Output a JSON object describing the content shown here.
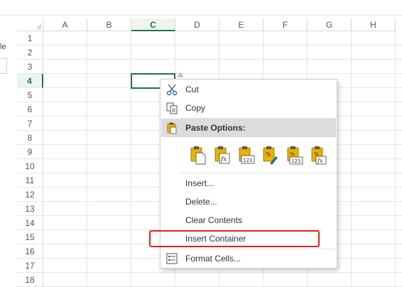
{
  "sidebar": {
    "label": "le"
  },
  "sheet": {
    "columns": [
      "A",
      "B",
      "C",
      "D",
      "E",
      "F",
      "G",
      "H"
    ],
    "selected_column": "C",
    "rows": [
      "1",
      "2",
      "3",
      "4",
      "5",
      "6",
      "7",
      "8",
      "9",
      "10",
      "11",
      "12",
      "13",
      "14",
      "15",
      "16",
      "17",
      "18"
    ],
    "selected_row": "4",
    "accent_color": "#217346"
  },
  "context_menu": {
    "cut": {
      "label": "Cut",
      "icon": "scissors-icon"
    },
    "copy": {
      "label": "Copy",
      "icon": "copy-icon"
    },
    "paste_options": {
      "label": "Paste Options:",
      "icon": "clipboard-icon"
    },
    "paste_buttons": [
      {
        "icon": "paste-icon",
        "glyph": ""
      },
      {
        "icon": "paste-formulas-icon",
        "glyph": "fx"
      },
      {
        "icon": "paste-values-icon",
        "glyph": "123"
      },
      {
        "icon": "paste-formatting-icon",
        "glyph": "%"
      },
      {
        "icon": "paste-values-number-formatting-icon",
        "glyph": "123"
      },
      {
        "icon": "paste-formulas-number-formatting-icon",
        "glyph": "fx"
      }
    ],
    "insert": {
      "label": "Insert..."
    },
    "delete": {
      "label": "Delete..."
    },
    "clear_contents": {
      "label": "Clear Contents"
    },
    "insert_container": {
      "label": "Insert Container"
    },
    "format_cells": {
      "label": "Format Cells...",
      "icon": "format-cells-icon"
    }
  },
  "highlight_color": "#e0221d"
}
